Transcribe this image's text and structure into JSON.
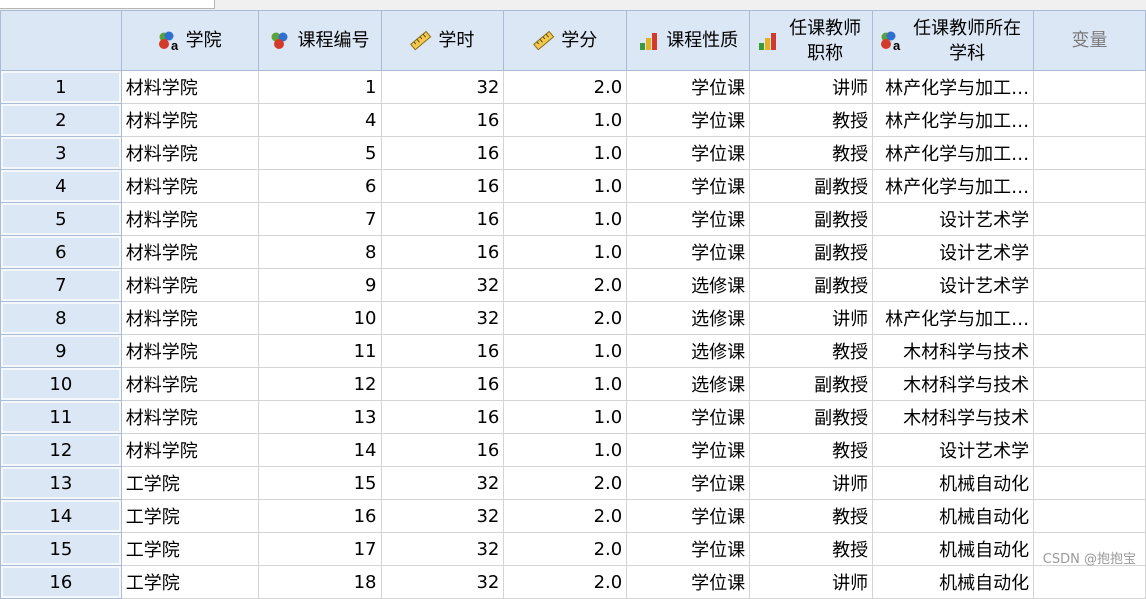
{
  "headers": [
    {
      "label": "学院",
      "icon": "nominal-variable-icon"
    },
    {
      "label": "课程编号",
      "icon": "nominal-variable-icon"
    },
    {
      "label": "学时",
      "icon": "scale-ruler-icon"
    },
    {
      "label": "学分",
      "icon": "scale-ruler-icon"
    },
    {
      "label": "课程性质",
      "icon": "ordinal-bar-icon"
    },
    {
      "label": "任课教师职称",
      "icon": "ordinal-bar-icon"
    },
    {
      "label": "任课教师所在学科",
      "icon": "nominal-variable-icon"
    },
    {
      "label": "变量",
      "icon": ""
    }
  ],
  "rows": [
    {
      "n": "1",
      "cells": [
        "材料学院",
        "1",
        "32",
        "2.0",
        "学位课",
        "讲师",
        "林产化学与加工…"
      ]
    },
    {
      "n": "2",
      "cells": [
        "材料学院",
        "4",
        "16",
        "1.0",
        "学位课",
        "教授",
        "林产化学与加工…"
      ]
    },
    {
      "n": "3",
      "cells": [
        "材料学院",
        "5",
        "16",
        "1.0",
        "学位课",
        "教授",
        "林产化学与加工…"
      ]
    },
    {
      "n": "4",
      "cells": [
        "材料学院",
        "6",
        "16",
        "1.0",
        "学位课",
        "副教授",
        "林产化学与加工…"
      ]
    },
    {
      "n": "5",
      "cells": [
        "材料学院",
        "7",
        "16",
        "1.0",
        "学位课",
        "副教授",
        "设计艺术学"
      ]
    },
    {
      "n": "6",
      "cells": [
        "材料学院",
        "8",
        "16",
        "1.0",
        "学位课",
        "副教授",
        "设计艺术学"
      ]
    },
    {
      "n": "7",
      "cells": [
        "材料学院",
        "9",
        "32",
        "2.0",
        "选修课",
        "副教授",
        "设计艺术学"
      ]
    },
    {
      "n": "8",
      "cells": [
        "材料学院",
        "10",
        "32",
        "2.0",
        "选修课",
        "讲师",
        "林产化学与加工…"
      ]
    },
    {
      "n": "9",
      "cells": [
        "材料学院",
        "11",
        "16",
        "1.0",
        "选修课",
        "教授",
        "木材科学与技术"
      ]
    },
    {
      "n": "10",
      "cells": [
        "材料学院",
        "12",
        "16",
        "1.0",
        "选修课",
        "副教授",
        "木材科学与技术"
      ]
    },
    {
      "n": "11",
      "cells": [
        "材料学院",
        "13",
        "16",
        "1.0",
        "学位课",
        "副教授",
        "木材科学与技术"
      ]
    },
    {
      "n": "12",
      "cells": [
        "材料学院",
        "14",
        "16",
        "1.0",
        "学位课",
        "教授",
        "设计艺术学"
      ]
    },
    {
      "n": "13",
      "cells": [
        "工学院",
        "15",
        "32",
        "2.0",
        "学位课",
        "讲师",
        "机械自动化"
      ]
    },
    {
      "n": "14",
      "cells": [
        "工学院",
        "16",
        "32",
        "2.0",
        "学位课",
        "教授",
        "机械自动化"
      ]
    },
    {
      "n": "15",
      "cells": [
        "工学院",
        "17",
        "32",
        "2.0",
        "学位课",
        "教授",
        "机械自动化"
      ]
    },
    {
      "n": "16",
      "cells": [
        "工学院",
        "18",
        "32",
        "2.0",
        "学位课",
        "讲师",
        "机械自动化"
      ]
    }
  ],
  "watermark": "CSDN @抱抱宝"
}
